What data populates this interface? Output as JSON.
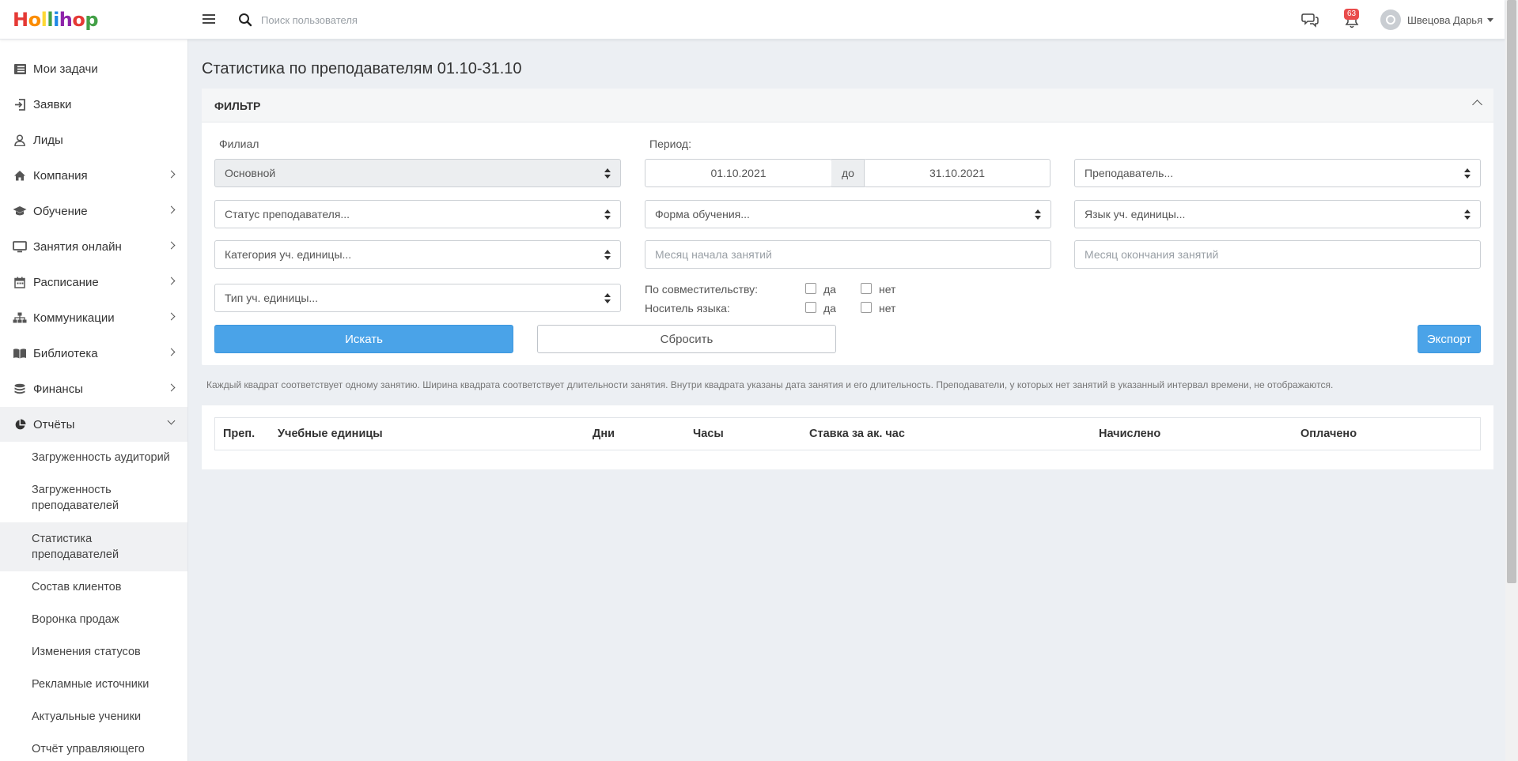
{
  "brand": {
    "logo_letters": [
      "H",
      "o",
      "l",
      "l",
      "i",
      "h",
      "o",
      "p"
    ],
    "logo_colors": [
      "#e53935",
      "#fb8c00",
      "#fdd835",
      "#43a047",
      "#1e88e5",
      "#8e24aa",
      "#e53935",
      "#43a047"
    ]
  },
  "header": {
    "search_placeholder": "Поиск пользователя",
    "notifications_count": "63",
    "user_name": "Швецова Дарья"
  },
  "sidebar": {
    "items": [
      {
        "label": "Мои задачи",
        "icon": "list-icon"
      },
      {
        "label": "Заявки",
        "icon": "sign-in-icon"
      },
      {
        "label": "Лиды",
        "icon": "user-icon"
      },
      {
        "label": "Компания",
        "icon": "home-icon"
      },
      {
        "label": "Обучение",
        "icon": "graduation-cap-icon"
      },
      {
        "label": "Занятия онлайн",
        "icon": "monitor-icon"
      },
      {
        "label": "Расписание",
        "icon": "calendar-icon"
      },
      {
        "label": "Коммуникации",
        "icon": "sitemap-icon"
      },
      {
        "label": "Библиотека",
        "icon": "book-icon"
      },
      {
        "label": "Финансы",
        "icon": "coins-icon"
      },
      {
        "label": "Отчёты",
        "icon": "pie-chart-icon"
      }
    ],
    "sub_items": [
      "Загруженность аудиторий",
      "Загруженность преподавателей",
      "Статистика преподавателей",
      "Состав клиентов",
      "Воронка продаж",
      "Изменения статусов",
      "Рекламные источники",
      "Актуальные ученики",
      "Отчёт управляющего"
    ]
  },
  "page": {
    "title": "Статистика по преподавателям 01.10-31.10"
  },
  "filter": {
    "title": "ФИЛЬТР",
    "branch_label": "Филиал",
    "branch_value": "Основной",
    "period_label": "Период:",
    "period_from": "01.10.2021",
    "period_to_label": "до",
    "period_to": "31.10.2021",
    "teacher_placeholder": "Преподаватель...",
    "teacher_status_placeholder": "Статус преподавателя...",
    "study_form_placeholder": "Форма обучения...",
    "unit_language_placeholder": "Язык уч. единицы...",
    "unit_category_placeholder": "Категория уч. единицы...",
    "start_month_placeholder": "Месяц начала занятий",
    "end_month_placeholder": "Месяц окончания занятий",
    "unit_type_placeholder": "Тип уч. единицы...",
    "part_time_label": "По совместительству:",
    "native_label": "Носитель языка:",
    "yes_label": "да",
    "no_label": "нет",
    "search_button": "Искать",
    "reset_button": "Сбросить",
    "export_button": "Экспорт"
  },
  "hint": "Каждый квадрат соответствует одному занятию. Ширина квадрата соответствует длительности занятия. Внутри квадрата указаны дата занятия и его длительность. Преподаватели, у которых нет занятий в указанный интервал времени, не отображаются.",
  "table": {
    "columns": [
      "Преп.",
      "Учебные единицы",
      "Дни",
      "Часы",
      "Ставка за ак. час",
      "Начислено",
      "Оплачено"
    ]
  }
}
